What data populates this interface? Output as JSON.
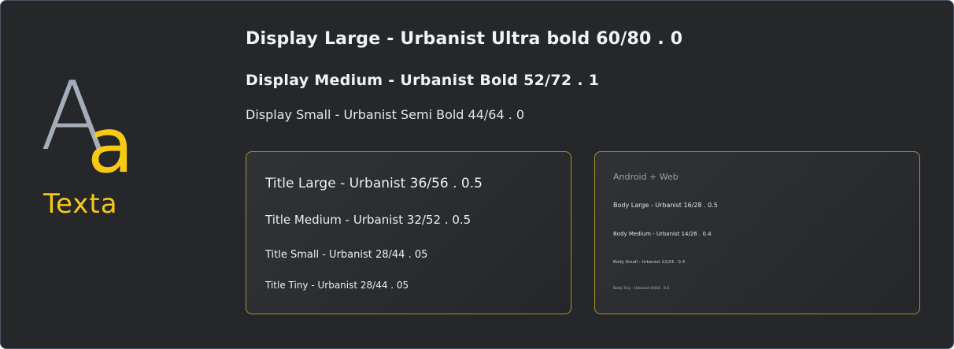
{
  "logo": {
    "big_letter": "A",
    "small_letter": "a",
    "wordmark": "Texta",
    "colors": {
      "big_letter": "#a5adb8",
      "accent": "#f6c915"
    }
  },
  "display": {
    "large": "Display Large - Urbanist Ultra bold 60/80 . 0",
    "medium": "Display Medium - Urbanist Bold 52/72 .  1",
    "small": "Display Small - Urbanist Semi Bold 44/64 . 0"
  },
  "title_card": {
    "large": "Title Large - Urbanist 36/56 . 0.5",
    "medium": "Title Medium - Urbanist 32/52 . 0.5",
    "small": "Title Small - Urbanist 28/44 . 05",
    "tiny": "Title Tiny - Urbanist 28/44 . 05"
  },
  "body_card": {
    "platform": "Android + Web",
    "large": "Body Large - Urbanist 16/28 . 0.5",
    "medium": "Body Medium - Urbanist 14/26 . 0.4",
    "small": "Body Small - Urbanist 12/24 . 0.4",
    "tiny": "Body Tiny - Urbanist 10/18 . 0.5"
  },
  "colors": {
    "background": "#25272b",
    "card_border": "#a8922a",
    "text": "#f2f3f5"
  }
}
